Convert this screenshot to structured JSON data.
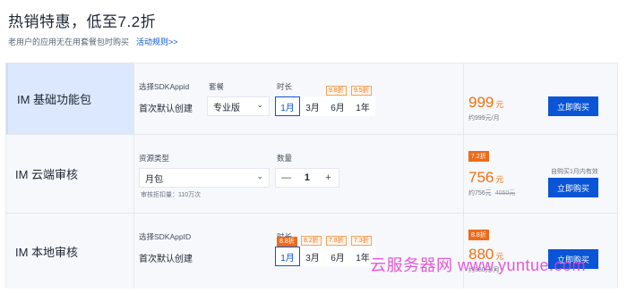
{
  "header": {
    "title": "热销特惠，低至7.2折",
    "subtitle": "老用户的应用无在用套餐包时购买",
    "rules_link": "活动规则>>"
  },
  "rows": [
    {
      "name": "IM 基础功能包",
      "label_a": "选择SDKAppid",
      "value_a": "首次默认创建",
      "label_b": "套餐",
      "plan_select": "专业版",
      "label_c": "时长",
      "durations": [
        {
          "label": "1月",
          "tag": "",
          "selected": true
        },
        {
          "label": "3月",
          "tag": "",
          "selected": false
        },
        {
          "label": "6月",
          "tag": "9.8折",
          "selected": false
        },
        {
          "label": "1年",
          "tag": "9.5折",
          "selected": false
        }
      ],
      "price": "999",
      "unit": "元",
      "per_month": "约999元/月",
      "buy": "立即购买"
    },
    {
      "name": "IM 云端审核",
      "label_a": "资源类型",
      "resource_select": "月包",
      "note": "审核拒扣量：110万次",
      "label_c": "数量",
      "qty": "1",
      "minus": "—",
      "plus": "+",
      "discount": "7.2折",
      "price": "756",
      "unit": "元",
      "per_month": "约756元",
      "orig": "4050元",
      "limit": "自购买1月内有效",
      "buy": "立即购买"
    },
    {
      "name": "IM 本地审核",
      "label_a": "选择SDKAppID",
      "value_a": "首次默认创建",
      "label_c": "时长",
      "durations": [
        {
          "label": "1月",
          "tag": "8.8折",
          "selected": true
        },
        {
          "label": "3月",
          "tag": "8.2折",
          "selected": false
        },
        {
          "label": "6月",
          "tag": "7.8折",
          "selected": false
        },
        {
          "label": "1年",
          "tag": "7.3折",
          "selected": false
        }
      ],
      "discount": "8.8折",
      "price": "880",
      "unit": "元",
      "per_month": "约880元/月",
      "buy": "立即购买"
    }
  ],
  "watermark": "云服务器网 www.yuntue.com"
}
